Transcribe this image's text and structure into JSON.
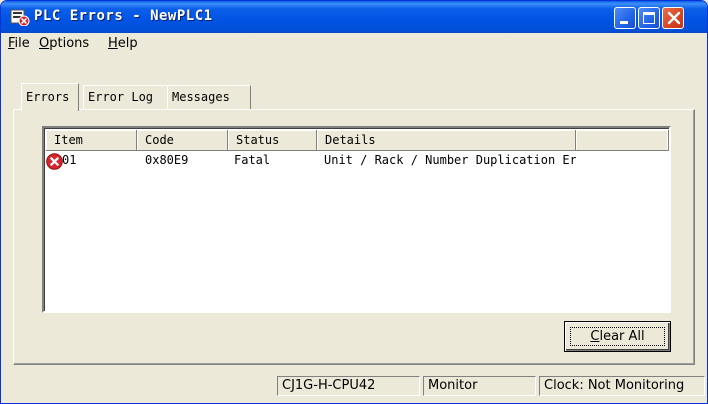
{
  "window": {
    "title": "PLC Errors - NewPLC1"
  },
  "menu": {
    "items": [
      {
        "accel": "F",
        "rest": "ile"
      },
      {
        "accel": "O",
        "rest": "ptions"
      },
      {
        "accel": "H",
        "rest": "elp"
      }
    ]
  },
  "tabs": [
    {
      "label": "Errors",
      "active": true
    },
    {
      "label": "Error Log",
      "active": false
    },
    {
      "label": "Messages",
      "active": false
    }
  ],
  "errors_list": {
    "columns": [
      "Item",
      "Code",
      "Status",
      "Details",
      ""
    ],
    "rows": [
      {
        "icon": "error-icon",
        "item": "01",
        "code": "0x80E9",
        "status": "Fatal",
        "details": "Unit / Rack / Number Duplication Er"
      }
    ]
  },
  "buttons": {
    "clear_all": {
      "accel": "C",
      "rest": "lear All"
    }
  },
  "statusbar": {
    "model": "CJ1G-H-CPU42",
    "mode": "Monitor",
    "clock": "Clock: Not Monitoring"
  },
  "colors": {
    "titlebar": "#0054e3",
    "error_icon": "#d8262c"
  }
}
